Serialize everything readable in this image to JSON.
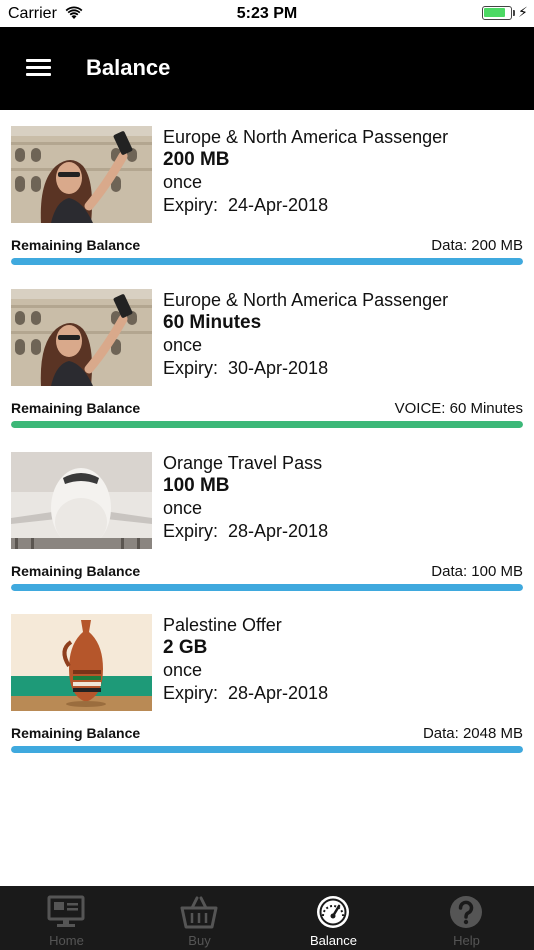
{
  "status_bar": {
    "carrier": "Carrier",
    "time": "5:23 PM",
    "battery_level": 0.85
  },
  "header": {
    "title": "Balance"
  },
  "colors": {
    "data_bar": "#3fa9de",
    "voice_bar": "#3cb878",
    "header_bg": "#000000",
    "tabbar_bg": "#1a1a1a"
  },
  "plans": [
    {
      "name": "Europe & North America Passenger",
      "amount": "200 MB",
      "frequency": "once",
      "expiry": "Expiry:  24-Apr-2018",
      "remaining_label": "Remaining Balance",
      "remaining_value": "Data: 200 MB",
      "remaining_fraction": 1.0,
      "bar_type": "data",
      "image": "woman-selfie-colosseum"
    },
    {
      "name": "Europe & North America Passenger",
      "amount": "60 Minutes",
      "frequency": "once",
      "expiry": "Expiry:  30-Apr-2018",
      "remaining_label": "Remaining Balance",
      "remaining_value": "VOICE: 60 Minutes",
      "remaining_fraction": 1.0,
      "bar_type": "voice",
      "image": "woman-selfie-colosseum"
    },
    {
      "name": "Orange Travel Pass",
      "amount": "100 MB",
      "frequency": "once",
      "expiry": "Expiry:  28-Apr-2018",
      "remaining_label": "Remaining Balance",
      "remaining_value": "Data: 100 MB",
      "remaining_fraction": 1.0,
      "bar_type": "data",
      "image": "airplane-front"
    },
    {
      "name": "Palestine Offer",
      "amount": "2 GB",
      "frequency": "once",
      "expiry": "Expiry:  28-Apr-2018",
      "remaining_label": "Remaining Balance",
      "remaining_value": "Data: 2048 MB",
      "remaining_fraction": 1.0,
      "bar_type": "data",
      "image": "clay-jug"
    }
  ],
  "tabs": [
    {
      "label": "Home",
      "icon": "monitor-icon",
      "active": false
    },
    {
      "label": "Buy",
      "icon": "basket-icon",
      "active": false
    },
    {
      "label": "Balance",
      "icon": "gauge-icon",
      "active": true
    },
    {
      "label": "Help",
      "icon": "question-icon",
      "active": false
    }
  ]
}
